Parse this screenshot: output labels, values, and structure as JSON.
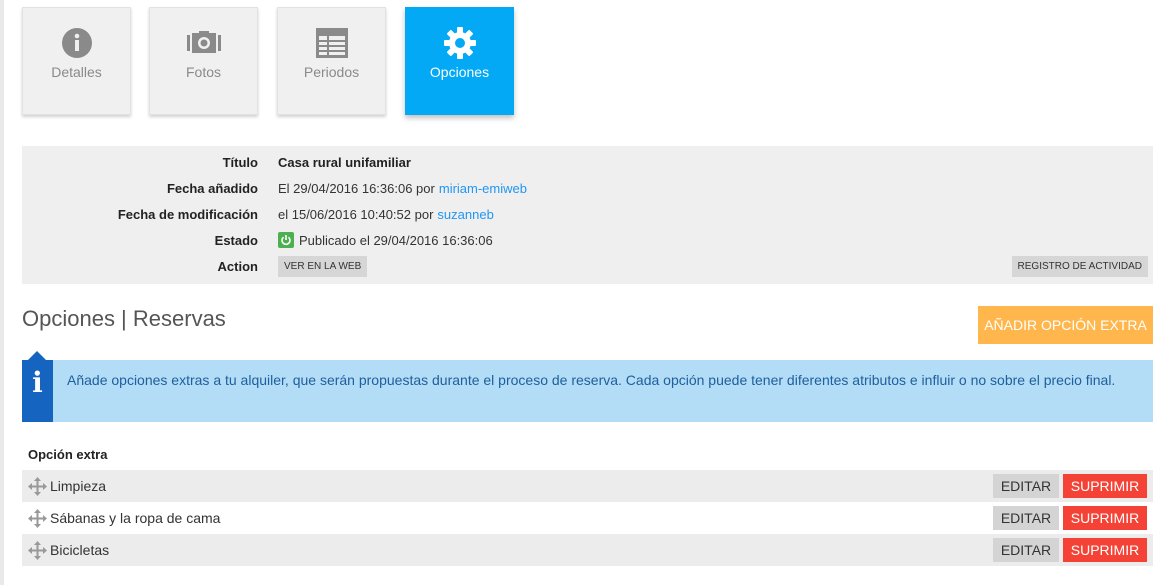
{
  "tabs": [
    {
      "label": "Detalles",
      "icon": "info-icon",
      "active": false
    },
    {
      "label": "Fotos",
      "icon": "camera-icon",
      "active": false
    },
    {
      "label": "Periodos",
      "icon": "calendar-grid-icon",
      "active": false
    },
    {
      "label": "Opciones",
      "icon": "gear-icon",
      "active": true
    }
  ],
  "details": {
    "titulo_label": "Título",
    "titulo_value": "Casa rural unifamiliar",
    "fecha_anadido_label": "Fecha añadido",
    "fecha_anadido_value": "El 29/04/2016 16:36:06 por",
    "fecha_anadido_user": "miriam-emiweb",
    "fecha_mod_label": "Fecha de modificación",
    "fecha_mod_value": "el 15/06/2016 10:40:52 por",
    "fecha_mod_user": "suzanneb",
    "estado_label": "Estado",
    "estado_value": "Publicado el 29/04/2016 16:36:06",
    "action_label": "Action",
    "ver_web_label": "VER EN LA WEB",
    "registro_label": "REGISTRO DE ACTIVIDAD"
  },
  "section": {
    "title": "Opciones | Reservas",
    "add_button": "AÑADIR OPCIÓN EXTRA"
  },
  "alert": {
    "icon": "info-icon",
    "text": "Añade opciones extras a tu alquiler, que serán propuestas durante el proceso de reserva. Cada opción puede tener diferentes atributos e influir o no sobre el precio final."
  },
  "table": {
    "header": "Opción extra",
    "edit_label": "EDITAR",
    "delete_label": "SUPRIMIR",
    "rows": [
      {
        "label": "Limpieza"
      },
      {
        "label": "Sábanas y la ropa de cama"
      },
      {
        "label": "Bicicletas"
      }
    ]
  },
  "colors": {
    "accent": "#03a9f4",
    "add_button": "#ffb74d",
    "delete": "#f44336",
    "status": "#4caf50",
    "alert_bg": "#b3dcf7",
    "alert_flag": "#1565c0"
  }
}
